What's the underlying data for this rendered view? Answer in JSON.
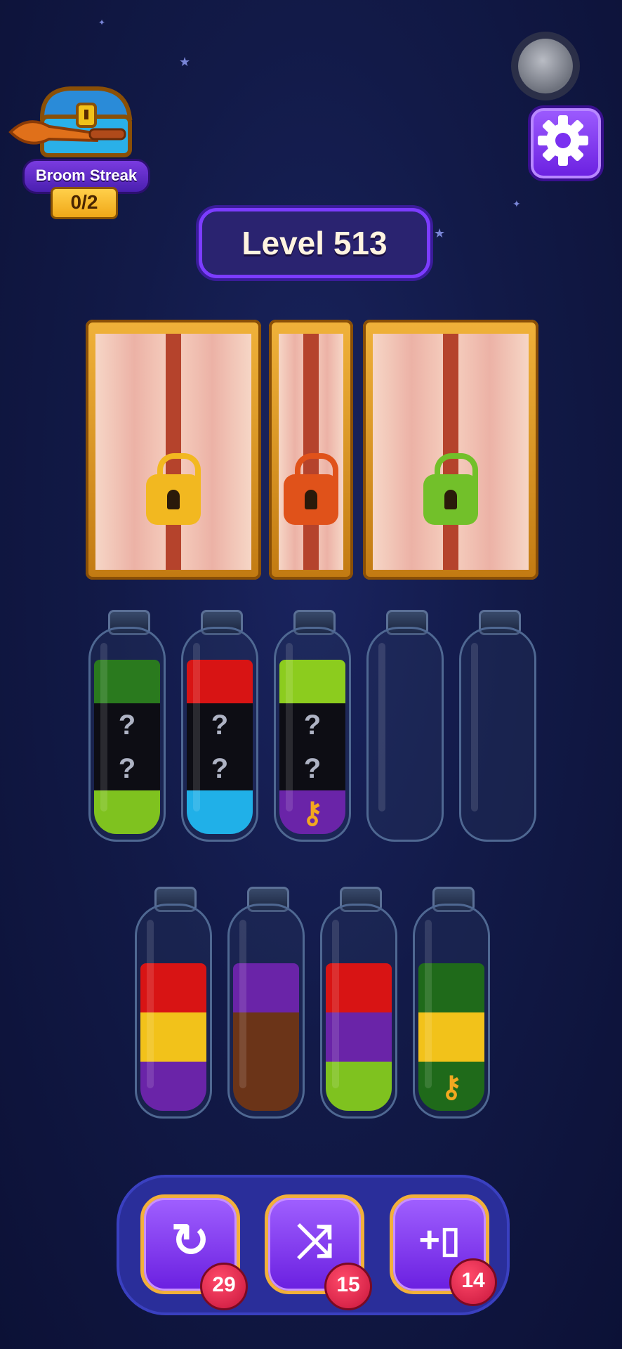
{
  "broom_streak": {
    "label": "Broom Streak",
    "count": "0/2"
  },
  "level": {
    "title": "Level 513"
  },
  "doors": [
    {
      "lock_color": "#f2b820"
    },
    {
      "lock_color": "#e0521a"
    },
    {
      "lock_color": "#72c02a"
    }
  ],
  "bottles_top": [
    {
      "layers": [
        {
          "color": "#2a7a1e",
          "text": ""
        },
        {
          "color": "#0d0d14",
          "text": "?"
        },
        {
          "color": "#0d0d14",
          "text": "?"
        },
        {
          "color": "#7fc21f",
          "text": ""
        }
      ]
    },
    {
      "layers": [
        {
          "color": "#d81414",
          "text": ""
        },
        {
          "color": "#0d0d14",
          "text": "?"
        },
        {
          "color": "#0d0d14",
          "text": "?"
        },
        {
          "color": "#20b0e8",
          "text": ""
        }
      ]
    },
    {
      "layers": [
        {
          "color": "#8ccc1e",
          "text": ""
        },
        {
          "color": "#0d0d14",
          "text": "?"
        },
        {
          "color": "#0d0d14",
          "text": "?"
        },
        {
          "color": "#6a24a8",
          "text": "key"
        }
      ]
    },
    {
      "layers": []
    },
    {
      "layers": []
    }
  ],
  "bottles_bottom": [
    {
      "layers": [
        {
          "color": "#d81414",
          "text": ""
        },
        {
          "color": "#f2c21a",
          "text": ""
        },
        {
          "color": "#6a24a8",
          "text": ""
        }
      ]
    },
    {
      "layers": [
        {
          "color": "#6a24a8",
          "text": ""
        },
        {
          "color": "#6b3418",
          "text": ""
        },
        {
          "color": "#6b3418",
          "text": ""
        }
      ]
    },
    {
      "layers": [
        {
          "color": "#d81414",
          "text": ""
        },
        {
          "color": "#6a24a8",
          "text": ""
        },
        {
          "color": "#7fc21f",
          "text": ""
        }
      ]
    },
    {
      "layers": [
        {
          "color": "#1f6a1a",
          "text": ""
        },
        {
          "color": "#f2c21a",
          "text": ""
        },
        {
          "color": "#1f6a1a",
          "text": "key"
        }
      ]
    }
  ],
  "powerups": {
    "undo": {
      "icon": "undo-icon",
      "count": "29"
    },
    "shuffle": {
      "icon": "shuffle-icon",
      "count": "15"
    },
    "add_bottle": {
      "icon": "add-bottle-icon",
      "count": "14"
    }
  }
}
